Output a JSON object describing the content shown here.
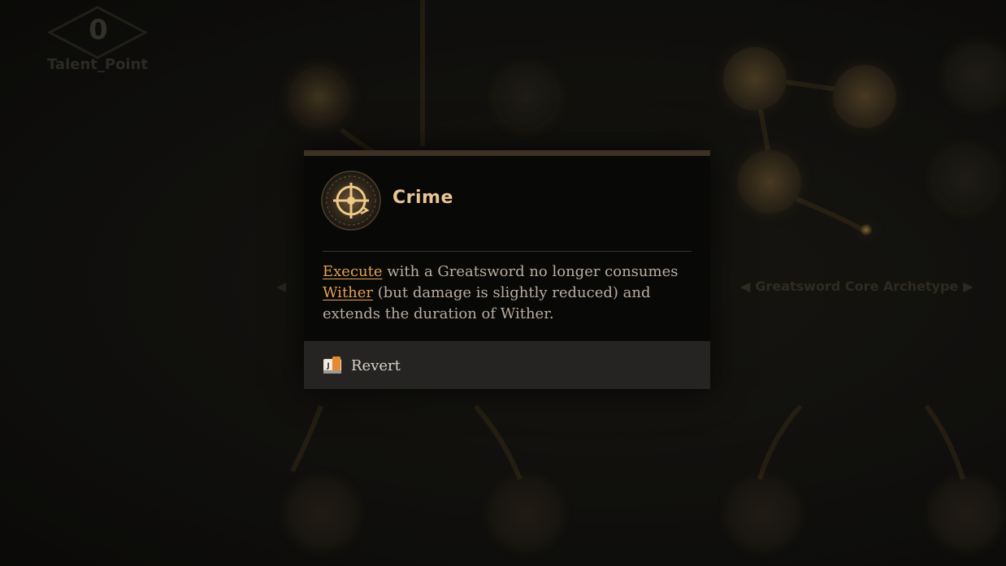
{
  "talent_points": {
    "value": "0",
    "label": "Talent_Point"
  },
  "archetype": {
    "name": "Greatsword Core Archetype",
    "prev_arrow": "◀",
    "next_arrow": "▶"
  },
  "tooltip": {
    "title": "Crime",
    "icon": "crosshair-emblem-icon",
    "description": {
      "keyword_1": "Execute",
      "text_1": " with a Greatsword no longer consumes ",
      "keyword_2": "Wither",
      "text_2": " (but damage is slightly reduced) and extends the duration of Wither."
    },
    "action": {
      "icon": "revert-book-icon",
      "label": "Revert"
    }
  },
  "colors": {
    "title": "#e8c594",
    "keyword": "#e3a153",
    "description": "#b9ada0",
    "panel": "#080807",
    "footer": "#252422",
    "accent_bar": "#3d3025"
  }
}
